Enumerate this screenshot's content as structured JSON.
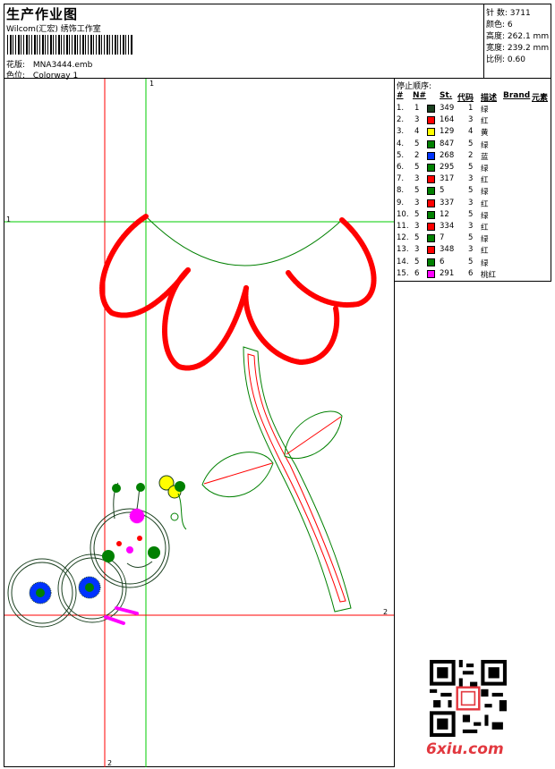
{
  "header": {
    "title": "生产作业图",
    "company": "Wilcom(汇宏)  绣饰工作室",
    "design_file_label": "花版:",
    "design_file": "MNA3444.emb",
    "colorway_label": "色位:",
    "colorway": "Colorway 1"
  },
  "stats": [
    {
      "label": "针 数:",
      "value": "3711"
    },
    {
      "label": "颜色:",
      "value": "6"
    },
    {
      "label": "高度:",
      "value": "262.1 mm"
    },
    {
      "label": "宽度:",
      "value": "239.2 mm"
    },
    {
      "label": "比例:",
      "value": "0.60"
    }
  ],
  "stops": {
    "title": "停止顺序:",
    "headers": [
      "#",
      "N#",
      "St.",
      "代码",
      "描述",
      "Brand",
      "元素"
    ],
    "rows": [
      {
        "n": "1.",
        "nn": "1",
        "color": "#1b4020",
        "st": "349",
        "code": "1",
        "desc": "绿"
      },
      {
        "n": "2.",
        "nn": "3",
        "color": "#ff0000",
        "st": "164",
        "code": "3",
        "desc": "红"
      },
      {
        "n": "3.",
        "nn": "4",
        "color": "#ffff00",
        "st": "129",
        "code": "4",
        "desc": "黄"
      },
      {
        "n": "4.",
        "nn": "5",
        "color": "#008000",
        "st": "847",
        "code": "5",
        "desc": "绿"
      },
      {
        "n": "5.",
        "nn": "2",
        "color": "#0033ff",
        "st": "268",
        "code": "2",
        "desc": "蓝"
      },
      {
        "n": "6.",
        "nn": "5",
        "color": "#008000",
        "st": "295",
        "code": "5",
        "desc": "绿"
      },
      {
        "n": "7.",
        "nn": "3",
        "color": "#ff0000",
        "st": "317",
        "code": "3",
        "desc": "红"
      },
      {
        "n": "8.",
        "nn": "5",
        "color": "#008000",
        "st": "5",
        "code": "5",
        "desc": "绿"
      },
      {
        "n": "9.",
        "nn": "3",
        "color": "#ff0000",
        "st": "337",
        "code": "3",
        "desc": "红"
      },
      {
        "n": "10.",
        "nn": "5",
        "color": "#008000",
        "st": "12",
        "code": "5",
        "desc": "绿"
      },
      {
        "n": "11.",
        "nn": "3",
        "color": "#ff0000",
        "st": "334",
        "code": "3",
        "desc": "红"
      },
      {
        "n": "12.",
        "nn": "5",
        "color": "#008000",
        "st": "7",
        "code": "5",
        "desc": "绿"
      },
      {
        "n": "13.",
        "nn": "3",
        "color": "#ff0000",
        "st": "348",
        "code": "3",
        "desc": "红"
      },
      {
        "n": "14.",
        "nn": "5",
        "color": "#008000",
        "st": "6",
        "code": "5",
        "desc": "绿"
      },
      {
        "n": "15.",
        "nn": "6",
        "color": "#ff00ff",
        "st": "291",
        "code": "6",
        "desc": "桃红"
      }
    ]
  },
  "canvas": {
    "guide_labels": {
      "v1": "1",
      "h1": "1",
      "h2": "2",
      "v2": "2"
    }
  },
  "watermark": {
    "site": "6xiu.com"
  }
}
